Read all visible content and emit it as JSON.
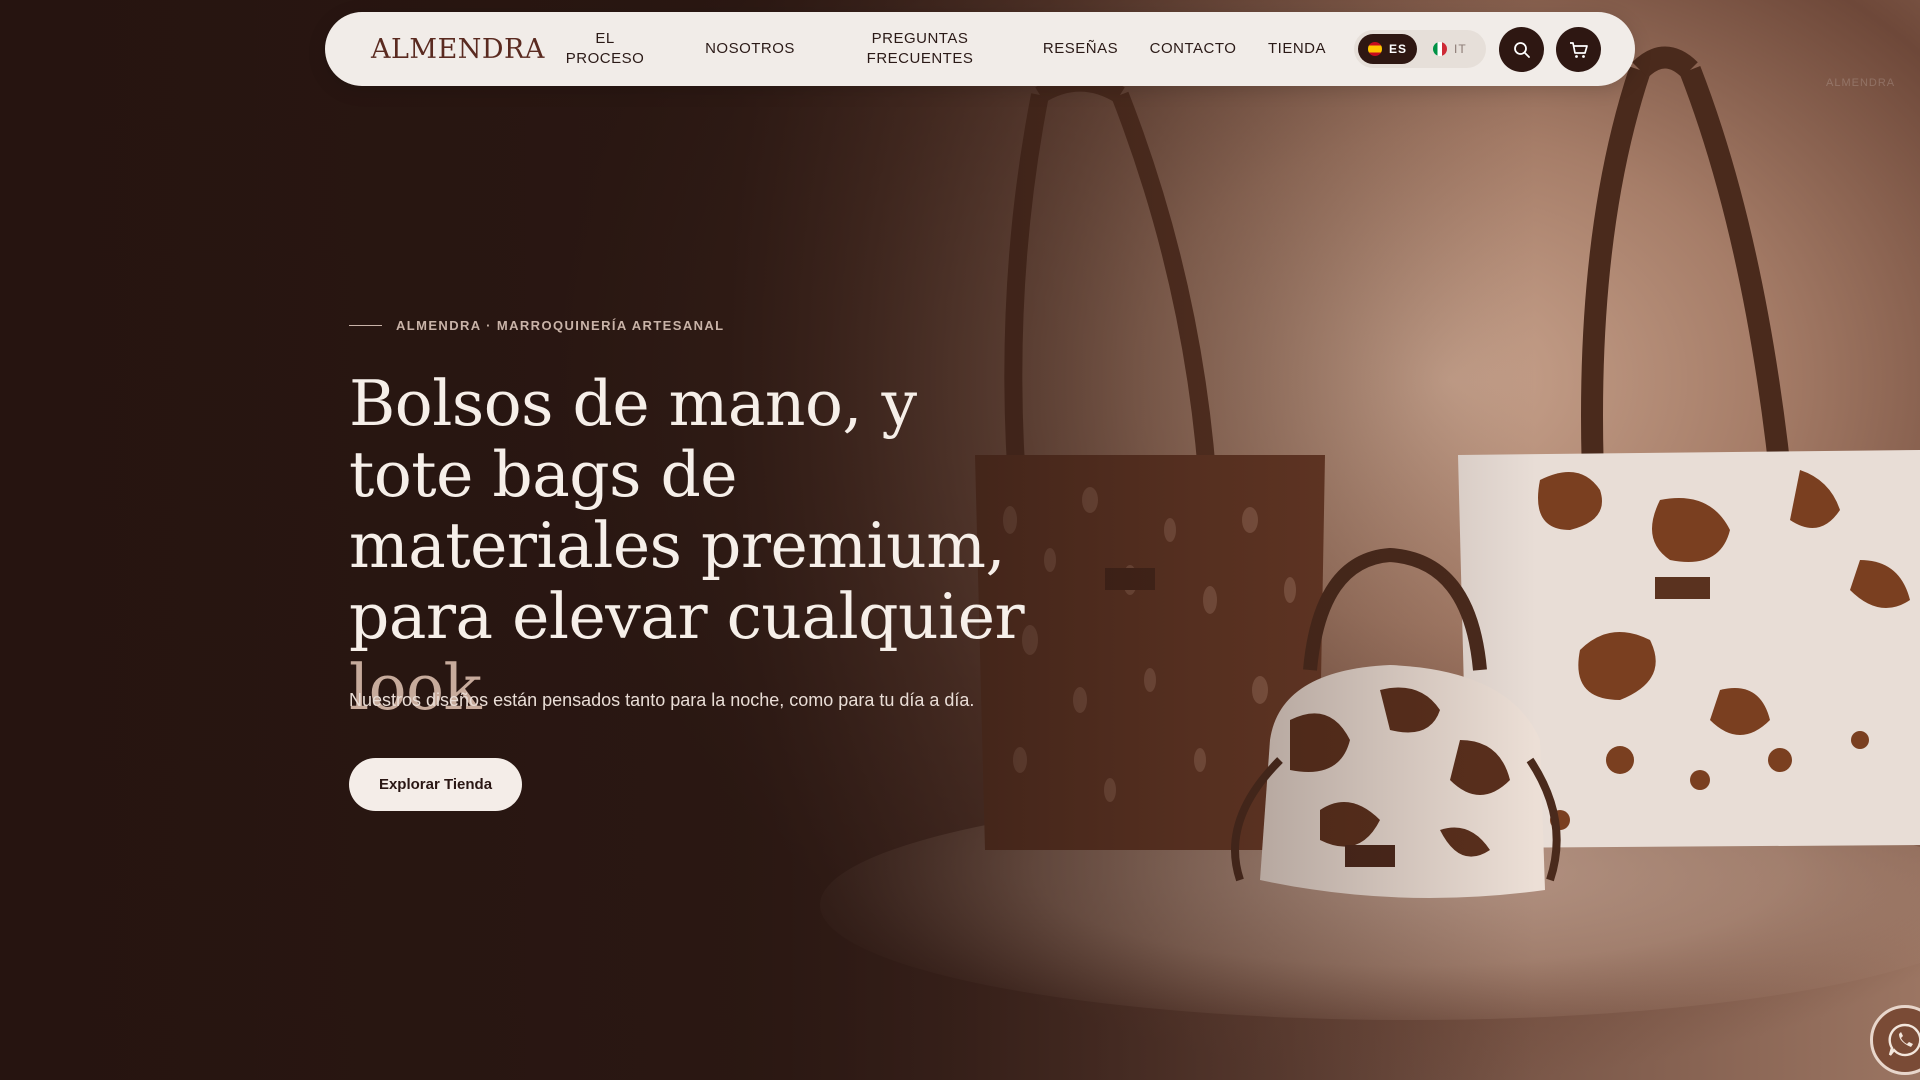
{
  "brand": {
    "name": "ALMENDRA"
  },
  "nav": {
    "items": [
      {
        "label": "EL\nPROCESO"
      },
      {
        "label": "NOSOTROS"
      },
      {
        "label": "PREGUNTAS\nFRECUENTES"
      },
      {
        "label": "RESEÑAS"
      },
      {
        "label": "CONTACTO"
      },
      {
        "label": "TIENDA"
      }
    ],
    "languages": [
      {
        "code": "ES",
        "active": true
      },
      {
        "code": "IT",
        "active": false
      }
    ],
    "icons": {
      "search": "search-icon",
      "cart": "cart-icon"
    }
  },
  "hero": {
    "eyebrow": "ALMENDRA · MARROQUINERÍA ARTESANAL",
    "headline_main": "Bolsos de mano, y tote bags de materiales premium, para elevar cualquier ",
    "headline_accent": "look",
    "subtitle": "Nuestros diseños están pensados tanto para la noche, como para tu día a día.",
    "cta": "Explorar Tienda"
  },
  "watermark": "ALMENDRA",
  "floating": {
    "icon": "whatsapp-icon"
  },
  "colors": {
    "dark_brown": "#2e1712",
    "logo_brown": "#5a2a20",
    "nav_bg": "#f1ece8",
    "headline": "#f6efe9",
    "accent": "#c7ab9c"
  }
}
